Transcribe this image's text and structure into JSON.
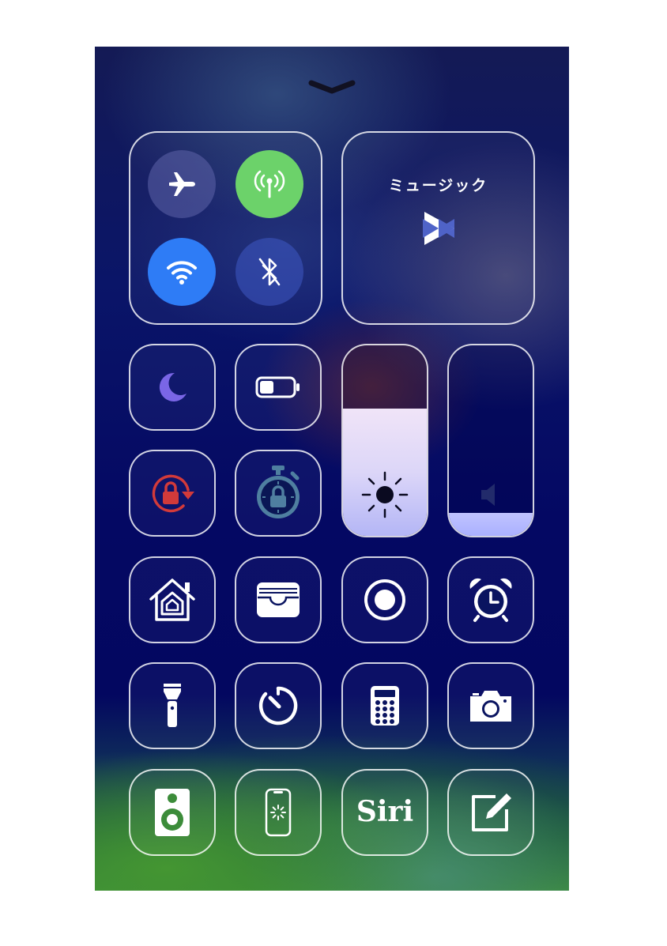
{
  "music": {
    "title": "ミュージック"
  },
  "connectivity": {
    "airplane": {
      "state": "off"
    },
    "cellular": {
      "state": "on"
    },
    "wifi": {
      "state": "on"
    },
    "bluetooth": {
      "state": "off"
    }
  },
  "sliders": {
    "brightness": {
      "level": 0.67
    },
    "volume": {
      "level": 0.12
    }
  },
  "tiles": [
    "do-not-disturb",
    "low-power-mode",
    "rotation-lock",
    "screen-time-lock",
    "home",
    "wallet",
    "screen-recording",
    "alarm",
    "flashlight",
    "timer",
    "calculator",
    "camera",
    "speaker",
    "iphone-restore",
    "siri",
    "notes"
  ],
  "siri": {
    "label": "Siri"
  },
  "colors": {
    "cellular_on": "#6cd26a",
    "wifi_on": "#2e7cf6",
    "moon": "#7a66e6",
    "rotation_lock": "#d23a3a",
    "timer_lock": "#4f7fa0",
    "speaker": "#3c8c3a"
  }
}
